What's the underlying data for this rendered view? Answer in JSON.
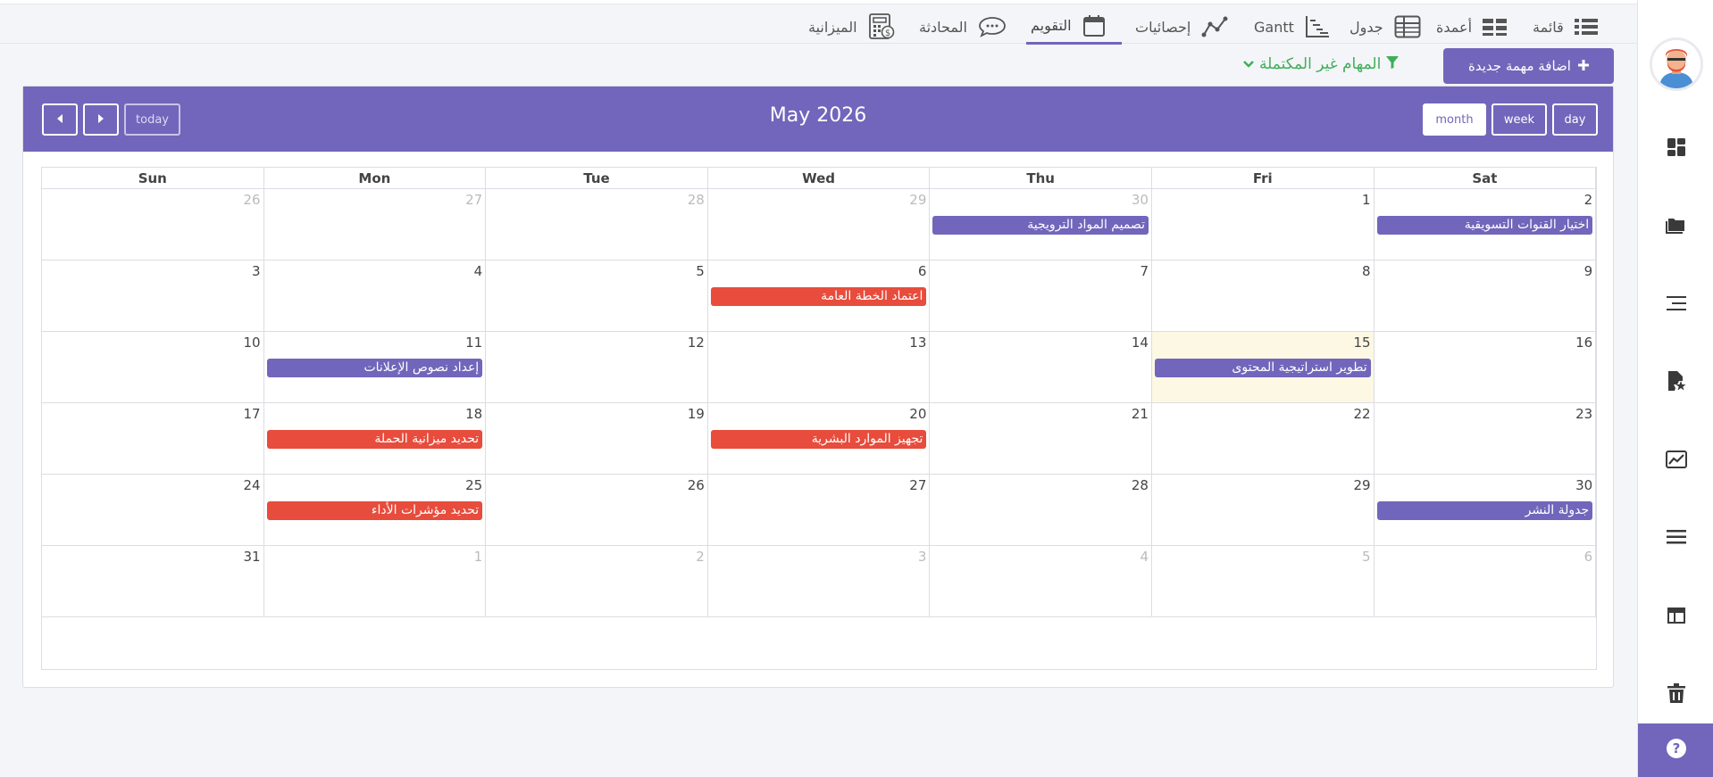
{
  "tabs": [
    {
      "id": "list",
      "label": "قائمة",
      "icon": "list-icon",
      "active": false
    },
    {
      "id": "columns",
      "label": "أعمدة",
      "icon": "columns-icon",
      "active": false
    },
    {
      "id": "table",
      "label": "جدول",
      "icon": "table-icon",
      "active": false
    },
    {
      "id": "gantt",
      "label": "Gantt",
      "icon": "gantt-icon",
      "active": false
    },
    {
      "id": "stats",
      "label": "إحصائيات",
      "icon": "line-chart-icon",
      "active": false
    },
    {
      "id": "calendar",
      "label": "التقويم",
      "icon": "calendar-icon",
      "active": true
    },
    {
      "id": "chat",
      "label": "المحادثة",
      "icon": "chat-icon",
      "active": false
    },
    {
      "id": "budget",
      "label": "الميزانية",
      "icon": "calculator-icon",
      "active": false
    }
  ],
  "toolbar": {
    "add_task_label": "اضافة مهمة جديدة",
    "filter_label": "المهام غير المكتملة"
  },
  "calendar": {
    "title": "May 2026",
    "today_label": "today",
    "view_buttons": [
      "month",
      "week",
      "day"
    ],
    "active_view": "month",
    "weekdays": [
      "Sun",
      "Mon",
      "Tue",
      "Wed",
      "Thu",
      "Fri",
      "Sat"
    ],
    "weeks": [
      [
        {
          "d": "26",
          "o": true
        },
        {
          "d": "27",
          "o": true
        },
        {
          "d": "28",
          "o": true
        },
        {
          "d": "29",
          "o": true
        },
        {
          "d": "30",
          "o": true
        },
        {
          "d": "1"
        },
        {
          "d": "2"
        }
      ],
      [
        {
          "d": "3"
        },
        {
          "d": "4"
        },
        {
          "d": "5"
        },
        {
          "d": "6"
        },
        {
          "d": "7"
        },
        {
          "d": "8"
        },
        {
          "d": "9"
        }
      ],
      [
        {
          "d": "10"
        },
        {
          "d": "11"
        },
        {
          "d": "12"
        },
        {
          "d": "13"
        },
        {
          "d": "14"
        },
        {
          "d": "15",
          "today": true
        },
        {
          "d": "16"
        }
      ],
      [
        {
          "d": "17"
        },
        {
          "d": "18"
        },
        {
          "d": "19"
        },
        {
          "d": "20"
        },
        {
          "d": "21"
        },
        {
          "d": "22"
        },
        {
          "d": "23"
        }
      ],
      [
        {
          "d": "24"
        },
        {
          "d": "25"
        },
        {
          "d": "26"
        },
        {
          "d": "27"
        },
        {
          "d": "28"
        },
        {
          "d": "29"
        },
        {
          "d": "30"
        }
      ],
      [
        {
          "d": "31"
        },
        {
          "d": "1",
          "o": true
        },
        {
          "d": "2",
          "o": true
        },
        {
          "d": "3",
          "o": true
        },
        {
          "d": "4",
          "o": true
        },
        {
          "d": "5",
          "o": true
        },
        {
          "d": "6",
          "o": true
        }
      ]
    ],
    "events": [
      {
        "week": 0,
        "day": 4,
        "title": "تصميم المواد الترويجية",
        "color": "#7166bb"
      },
      {
        "week": 0,
        "day": 6,
        "title": "اختيار القنوات التسويقية",
        "color": "#7166bb"
      },
      {
        "week": 1,
        "day": 3,
        "title": "اعتماد الخطة العامة",
        "color": "#e74c3c"
      },
      {
        "week": 2,
        "day": 1,
        "title": "إعداد نصوص الإعلانات",
        "color": "#7166bb"
      },
      {
        "week": 2,
        "day": 5,
        "title": "تطوير استراتيجية المحتوى",
        "color": "#7166bb"
      },
      {
        "week": 3,
        "day": 1,
        "title": "تحديد ميزانية الحملة",
        "color": "#e74c3c"
      },
      {
        "week": 3,
        "day": 3,
        "title": "تجهيز الموارد البشرية",
        "color": "#e74c3c"
      },
      {
        "week": 4,
        "day": 1,
        "title": "تحديد مؤشرات الأداء",
        "color": "#e74c3c"
      },
      {
        "week": 4,
        "day": 6,
        "title": "جدولة النشر",
        "color": "#7166bb"
      }
    ]
  },
  "sidebar_icons": [
    "dashboard-icon",
    "folder-icon",
    "align-right-icon",
    "file-star-icon",
    "chart-image-icon",
    "menu-icon",
    "layout-icon",
    "trash-icon"
  ],
  "colors": {
    "primary": "#7166bb",
    "danger": "#e74c3c",
    "success": "#3fae5a",
    "today": "#fcf8e3"
  }
}
